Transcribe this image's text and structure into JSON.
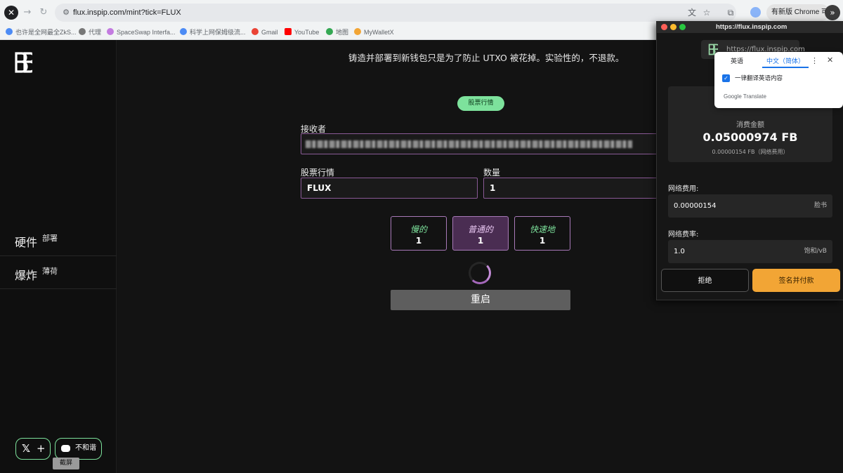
{
  "browser": {
    "url": "flux.inspip.com/mint?tick=FLUX",
    "update_label": "有新版 Chrome 可用",
    "bookmarks": [
      {
        "label": "也许是全网最全ZkS...",
        "color": "#4c8bf5"
      },
      {
        "label": "代理",
        "color": "#777777"
      },
      {
        "label": "SpaceSwap Interfa...",
        "color": "#c37be0"
      },
      {
        "label": "科学上网保姆级流...",
        "color": "#4c8bf5"
      },
      {
        "label": "Gmail",
        "color": "#ea4335"
      },
      {
        "label": "YouTube",
        "color": "#ff0000"
      },
      {
        "label": "地图",
        "color": "#34a853"
      },
      {
        "label": "MyWalletX",
        "color": "#f2a535"
      }
    ]
  },
  "sidebar": {
    "items": [
      {
        "big": "硬件",
        "small": "部署"
      },
      {
        "big": "爆炸",
        "small": "薄荷"
      }
    ],
    "discord_label": "不和谐",
    "tooltip": "截屏"
  },
  "main": {
    "notice": "铸造并部署到新钱包只是为了防止 UTXO 被花掉。实验性的，不退款。",
    "ticker_pill": "股票行情",
    "receiver_label": "接收者",
    "ticker_label": "股票行情",
    "ticker_value": "FLUX",
    "amount_label": "数量",
    "amount_value": "1",
    "speeds": [
      {
        "name": "慢的",
        "value": "1"
      },
      {
        "name": "普通的",
        "value": "1"
      },
      {
        "name": "快速地",
        "value": "1"
      }
    ],
    "restart_label": "重启"
  },
  "wallet": {
    "title": "https://flux.inspip.com",
    "site": "https://flux.inspip.com",
    "spend_label": "消费金额",
    "spend_amount": "0.05000974 FB",
    "spend_sub": "0.00000154 FB（网络费用）",
    "fee_label": "网络费用:",
    "fee_value": "0.00000154",
    "fee_unit": "脸书",
    "rate_label": "网络费率:",
    "rate_value": "1.0",
    "rate_unit": "饱和/vB",
    "reject_label": "拒绝",
    "sign_label": "签名并付款"
  },
  "translate": {
    "tab_source": "英语",
    "tab_target": "中文（简体）",
    "always_label": "一律翻译英语内容",
    "brand": "Google Translate"
  },
  "colors": {
    "accent_green": "#7de29c",
    "accent_purple": "#a879b8",
    "sign_orange": "#f2a535"
  }
}
